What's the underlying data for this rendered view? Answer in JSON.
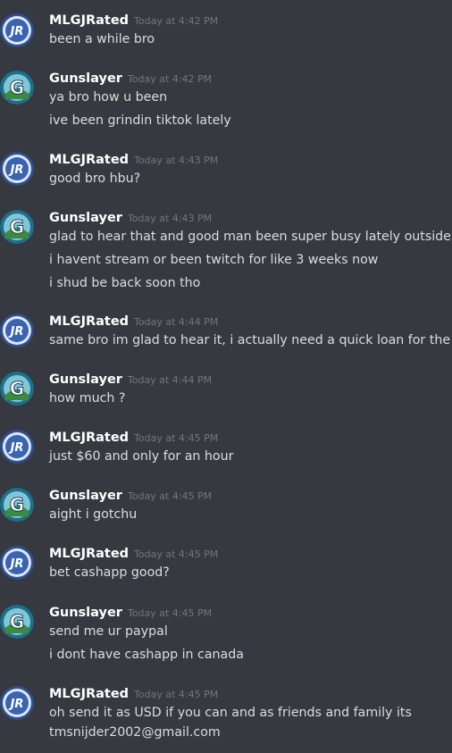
{
  "users": {
    "mlg": {
      "name": "MLGJRated",
      "avatar_icon": "jr-logo-avatar",
      "avatar_text": "JR"
    },
    "gun": {
      "name": "Gunslayer",
      "avatar_icon": "g-logo-avatar",
      "avatar_text": "G"
    }
  },
  "messages": [
    {
      "user": "MLGJRated",
      "time": "Today at 4:42 PM",
      "lines": [
        "been a while bro"
      ]
    },
    {
      "user": "Gunslayer",
      "time": "Today at 4:42 PM",
      "lines": [
        "ya bro how u been",
        "ive been grindin tiktok lately"
      ]
    },
    {
      "user": "MLGJRated",
      "time": "Today at 4:43 PM",
      "lines": [
        "good bro hbu?"
      ]
    },
    {
      "user": "Gunslayer",
      "time": "Today at 4:43 PM",
      "lines": [
        "glad to hear that and good man been super busy lately outside stream",
        "i havent stream or been twitch for like 3 weeks now",
        "i shud be back soon tho"
      ]
    },
    {
      "user": "MLGJRated",
      "time": "Today at 4:44 PM",
      "lines": [
        "same bro im glad to hear it, i actually need a quick loan for the one ti"
      ]
    },
    {
      "user": "Gunslayer",
      "time": "Today at 4:44 PM",
      "lines": [
        "how much ?"
      ]
    },
    {
      "user": "MLGJRated",
      "time": "Today at 4:45 PM",
      "lines": [
        "just $60 and only for an hour"
      ]
    },
    {
      "user": "Gunslayer",
      "time": "Today at 4:45 PM",
      "lines": [
        "aight i gotchu"
      ]
    },
    {
      "user": "MLGJRated",
      "time": "Today at 4:45 PM",
      "lines": [
        "bet cashapp good?"
      ]
    },
    {
      "user": "Gunslayer",
      "time": "Today at 4:45 PM",
      "lines": [
        "send me ur paypal",
        "i dont have cashapp in canada"
      ]
    },
    {
      "user": "MLGJRated",
      "time": "Today at 4:45 PM",
      "lines": [
        "oh send it as USD if you can and as friends and family its",
        "tmsnijder2002@gmail.com"
      ]
    }
  ]
}
